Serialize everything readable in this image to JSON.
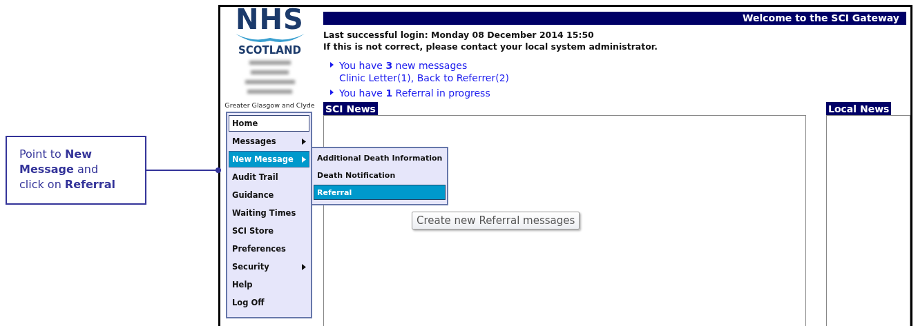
{
  "callout": {
    "text": "Point to **New Message** and click on **Referral**"
  },
  "logo": {
    "title": "NHS",
    "subtitle": "SCOTLAND"
  },
  "region": "Greater Glasgow and Clyde",
  "menu": [
    {
      "label": "Home",
      "current": true,
      "selected": false,
      "has_submenu": false
    },
    {
      "label": "Messages",
      "current": false,
      "selected": false,
      "has_submenu": true
    },
    {
      "label": "New Message",
      "current": false,
      "selected": true,
      "has_submenu": true
    },
    {
      "label": "Audit Trail",
      "current": false,
      "selected": false,
      "has_submenu": false
    },
    {
      "label": "Guidance",
      "current": false,
      "selected": false,
      "has_submenu": false
    },
    {
      "label": "Waiting Times",
      "current": false,
      "selected": false,
      "has_submenu": false
    },
    {
      "label": "SCI Store",
      "current": false,
      "selected": false,
      "has_submenu": false
    },
    {
      "label": "Preferences",
      "current": false,
      "selected": false,
      "has_submenu": false
    },
    {
      "label": "Security",
      "current": false,
      "selected": false,
      "has_submenu": true
    },
    {
      "label": "Help",
      "current": false,
      "selected": false,
      "has_submenu": false
    },
    {
      "label": "Log Off",
      "current": false,
      "selected": false,
      "has_submenu": false
    }
  ],
  "submenu": [
    {
      "label": "Additional Death Information",
      "selected": false
    },
    {
      "label": "Death Notification",
      "selected": false
    },
    {
      "label": "Referral",
      "selected": true
    }
  ],
  "tooltip": "Create new Referral messages",
  "header": {
    "title": "Welcome to the SCI Gateway"
  },
  "login_notice": [
    "Last successful login: Monday 08 December 2014 15:50",
    "If this is not correct, please contact your local system administrator."
  ],
  "notifications": [
    {
      "lines": [
        "You have **3** new messages",
        "Clinic Letter(1), Back to Referrer(2)"
      ]
    },
    {
      "lines": [
        "You have **1** Referral in progress"
      ]
    }
  ],
  "panels": [
    {
      "title": "SCI News"
    },
    {
      "title": "Local News"
    }
  ]
}
